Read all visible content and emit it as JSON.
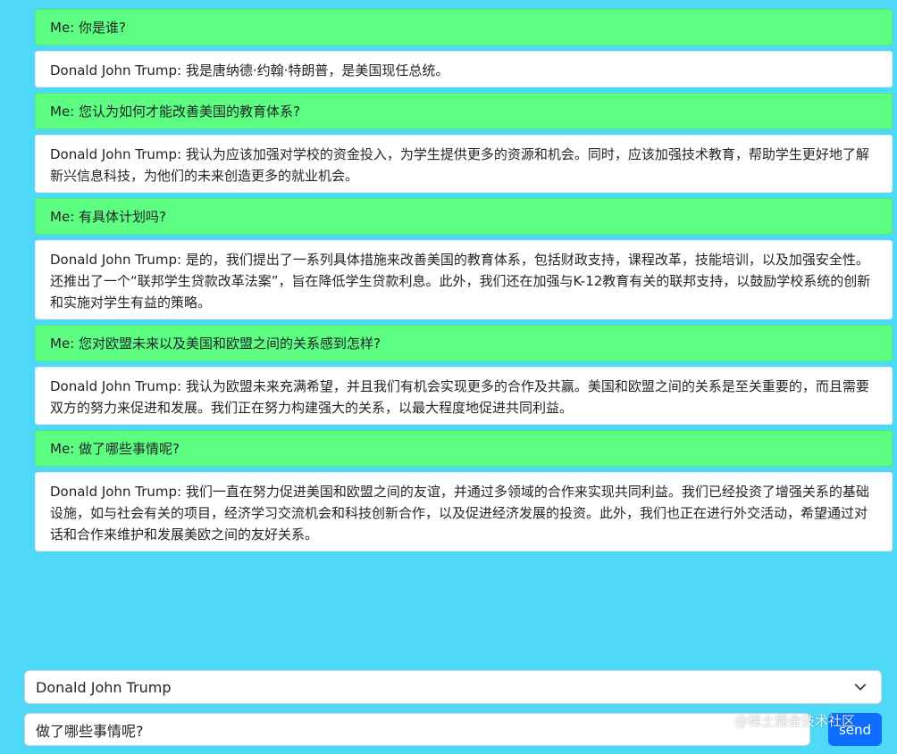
{
  "conversation": [
    {
      "role": "me",
      "text": "Me: 你是谁?"
    },
    {
      "role": "bot",
      "text": "Donald John Trump: 我是唐纳德·约翰·特朗普，是美国现任总统。"
    },
    {
      "role": "me",
      "text": "Me: 您认为如何才能改善美国的教育体系?"
    },
    {
      "role": "bot",
      "text": "Donald John Trump: 我认为应该加强对学校的资金投入，为学生提供更多的资源和机会。同时，应该加强技术教育，帮助学生更好地了解新兴信息科技，为他们的未来创造更多的就业机会。"
    },
    {
      "role": "me",
      "text": "Me: 有具体计划吗?"
    },
    {
      "role": "bot",
      "text": "Donald John Trump: 是的，我们提出了一系列具体措施来改善美国的教育体系，包括财政支持，课程改革，技能培训，以及加强安全性。还推出了一个“联邦学生贷款改革法案”，旨在降低学生贷款利息。此外，我们还在加强与K-12教育有关的联邦支持，以鼓励学校系统的创新和实施对学生有益的策略。"
    },
    {
      "role": "me",
      "text": "Me: 您对欧盟未来以及美国和欧盟之间的关系感到怎样?"
    },
    {
      "role": "bot",
      "text": "Donald John Trump: 我认为欧盟未来充满希望，并且我们有机会实现更多的合作及共赢。美国和欧盟之间的关系是至关重要的，而且需要双方的努力来促进和发展。我们正在努力构建强大的关系，以最大程度地促进共同利益。"
    },
    {
      "role": "me",
      "text": "Me: 做了哪些事情呢?"
    },
    {
      "role": "bot",
      "text": "Donald John Trump: 我们一直在努力促进美国和欧盟之间的友谊，并通过多领域的合作来实现共同利益。我们已经投资了增强关系的基础设施，如与社会有关的项目，经济学习交流机会和科技创新合作，以及促进经济发展的投资。此外，我们也正在进行外交活动，希望通过对话和合作来维护和发展美欧之间的友好关系。"
    }
  ],
  "model_select": {
    "value": "Donald John Trump",
    "icon": "chevron-down-icon"
  },
  "input": {
    "value": "做了哪些事情呢?"
  },
  "send_label": "send",
  "watermark": "@稀土掘金技术社区",
  "colors": {
    "background": "#4dd9f7",
    "me_bubble": "#5cfd81",
    "bot_bubble": "#ffffff",
    "send_button": "#0d6efd"
  }
}
